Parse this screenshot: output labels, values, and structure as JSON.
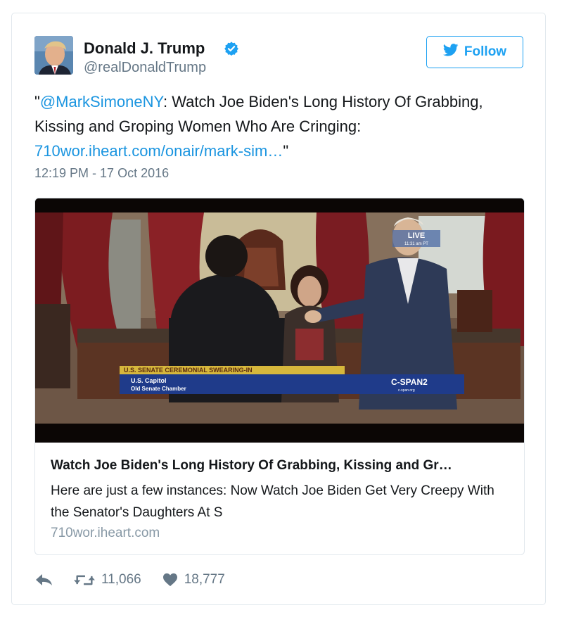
{
  "tweet": {
    "author_name": "Donald J. Trump",
    "author_handle": "@realDonaldTrump",
    "follow_label": "Follow",
    "text_prefix": "\"",
    "mention": "@MarkSimoneNY",
    "text_body": ": Watch Joe Biden's Long History Of Grabbing, Kissing and Groping Women Who Are Cringing: ",
    "url_text": "710wor.iheart.com/onair/mark-sim…",
    "text_suffix": "\"",
    "timestamp": "12:19 PM - 17 Oct 2016"
  },
  "media": {
    "video_overlay": {
      "live_badge": "LIVE",
      "live_time": "11:31 am PT",
      "banner": "U.S. SENATE CEREMONIAL SWEARING-IN",
      "location_line1": "U.S. Capitol",
      "location_line2": "Old Senate Chamber",
      "network": "C-SPAN2",
      "network_sub": "c-span.org"
    },
    "card_title": "Watch Joe Biden's Long History Of Grabbing, Kissing and Gr…",
    "card_description": "Here are just a few instances: Now Watch Joe Biden Get Very Creepy With the Senator's Daughters At S",
    "card_domain": "710wor.iheart.com"
  },
  "actions": {
    "retweet_count": "11,066",
    "like_count": "18,777"
  },
  "colors": {
    "accent": "#1da1f2",
    "link": "#1b95e0",
    "secondary_text": "#657786",
    "border": "#e1e8ed"
  },
  "icons": {
    "verified": "verified-badge-icon",
    "follow": "bird-icon",
    "reply": "reply-icon",
    "retweet": "retweet-icon",
    "like": "heart-icon"
  }
}
